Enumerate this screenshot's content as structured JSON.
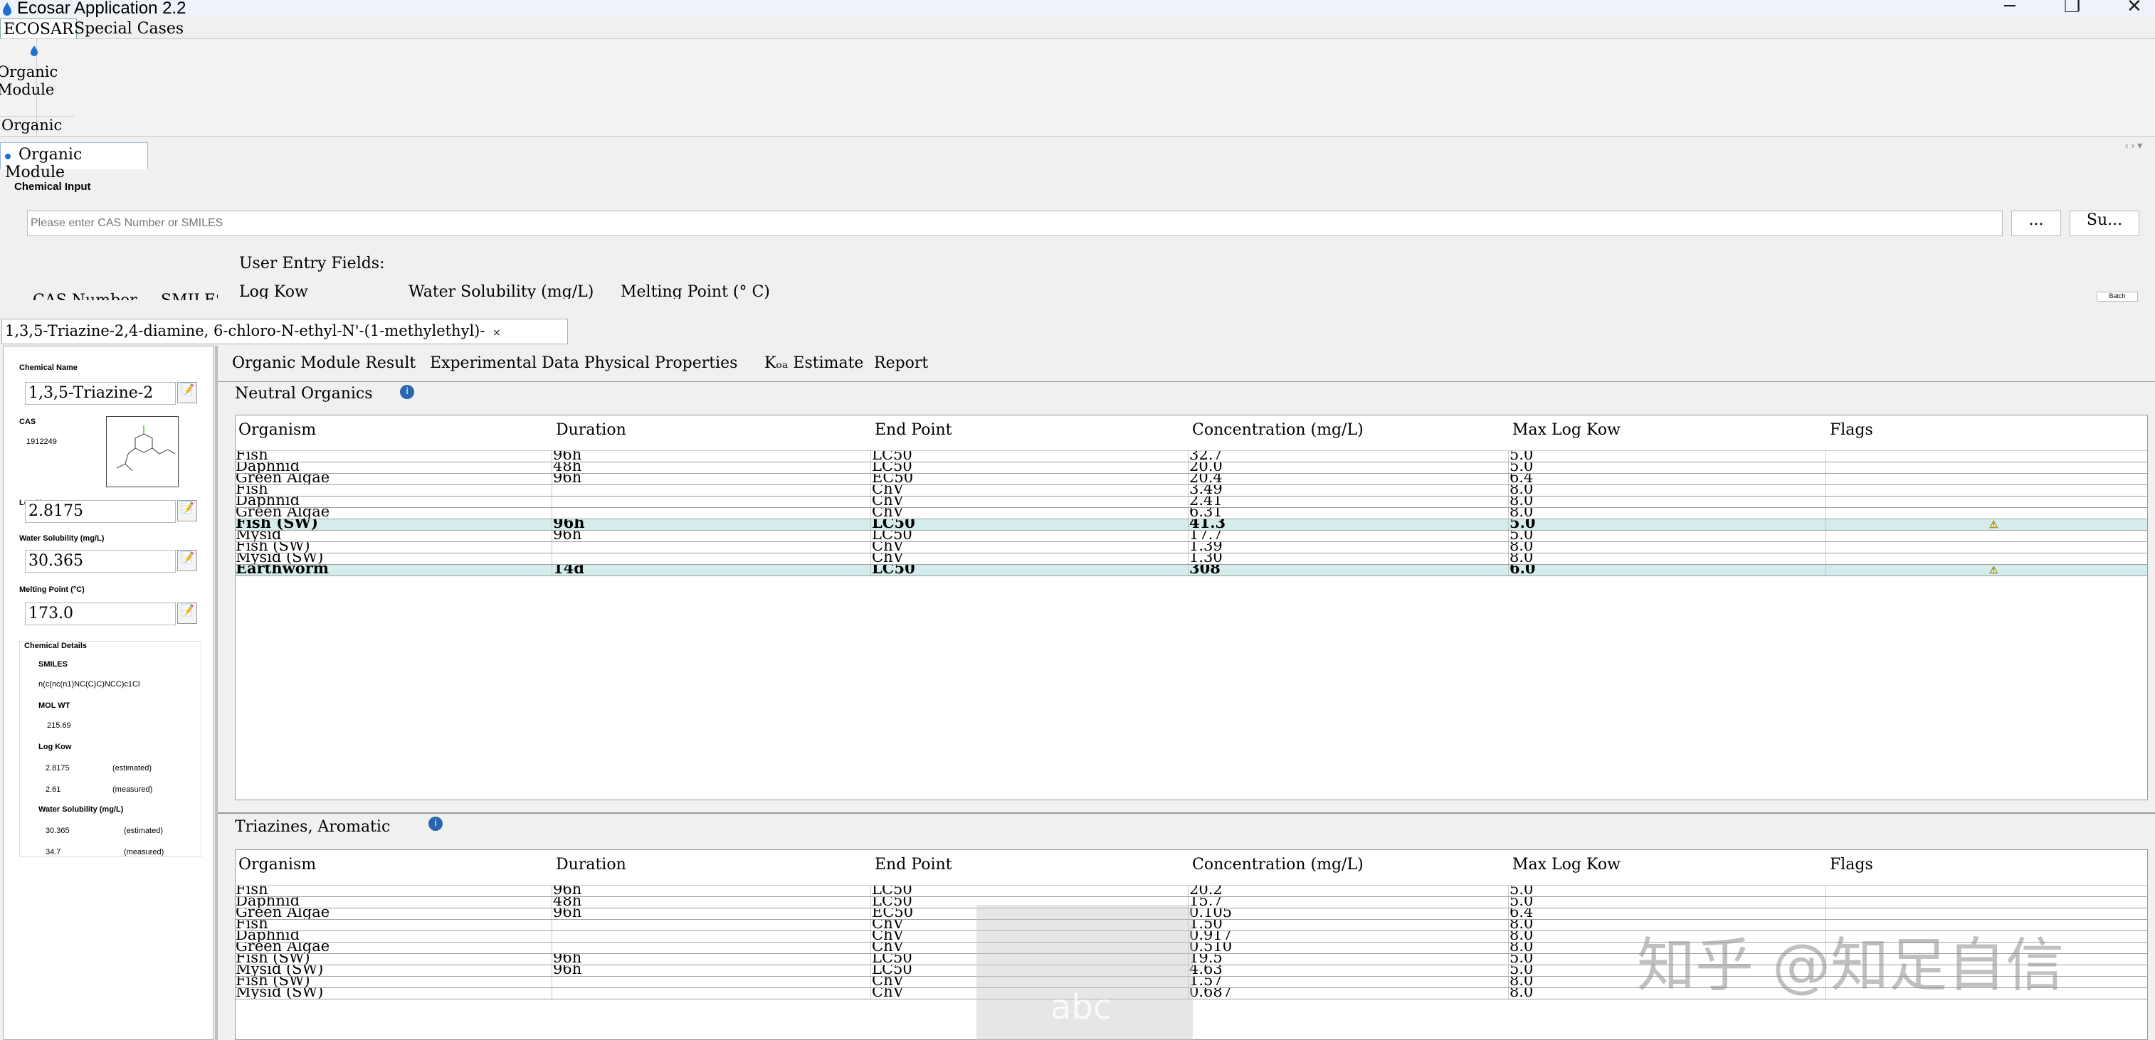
{
  "window": {
    "title": "Ecosar Application 2.2",
    "minimize": "─",
    "restore": "❐",
    "close": "✕"
  },
  "ribbon": {
    "tabs": [
      "ECOSAR",
      "Special Cases"
    ],
    "organic_button_label": "Organic Module",
    "group_label": "Organic"
  },
  "doc_tab": "Organic Module",
  "chemical_input": {
    "label": "Chemical Input",
    "placeholder": "Please enter CAS Number or SMILES",
    "browse_label": "...",
    "submit_label": "Su...",
    "user_entry_label": "User Entry Fields:",
    "fields": [
      "Log Kow",
      "Water Solubility (mg/L)",
      "Melting Point (° C)"
    ],
    "col_headers": [
      "CAS Number",
      "SMILES"
    ],
    "batch_label": "Batch"
  },
  "result_tab": "1,3,5-Triazine-2,4-diamine, 6-chloro-N-ethyl-N'-(1-methylethyl)-",
  "left_panel": {
    "chemical_name_label": "Chemical Name",
    "chemical_name": "1,3,5-Triazine-2",
    "cas_label": "CAS",
    "cas": "1912249",
    "log_kow_label": "Log Kow",
    "log_kow": "2.8175",
    "ws_label": "Water Solubility (mg/L)",
    "ws": "30.365",
    "mp_label": "Melting Point (°C)",
    "mp": "173.0",
    "details_label": "Chemical Details",
    "smiles_label": "SMILES",
    "smiles": "n(c(nc(n1)NC(C)C)NCC)c1Cl",
    "molwt_label": "MOL WT",
    "molwt": "215.69",
    "dlogkow_label": "Log Kow",
    "logkow_est": "2.8175",
    "logkow_est_tag": "(estimated)",
    "logkow_meas": "2.61",
    "logkow_meas_tag": "(measured)",
    "dws_label": "Water Solubility (mg/L)",
    "ws_est": "30.365",
    "ws_est_tag": "(estimated)",
    "ws_meas": "34.7",
    "ws_meas_tag": "(measured)"
  },
  "main_tabs": [
    "Organic Module Result",
    "Experimental Data Physical Properties",
    "Kₒₐ Estimate",
    "Report"
  ],
  "columns": [
    "Organism",
    "Duration",
    "End Point",
    "Concentration (mg/L)",
    "Max Log Kow",
    "Flags"
  ],
  "neutral": {
    "title": "Neutral Organics",
    "rows": [
      {
        "o": "Fish",
        "d": "96h",
        "e": "LC50",
        "c": "32.7",
        "m": "5.0",
        "f": ""
      },
      {
        "o": "Daphnid",
        "d": "48h",
        "e": "LC50",
        "c": "20.0",
        "m": "5.0",
        "f": ""
      },
      {
        "o": "Green Algae",
        "d": "96h",
        "e": "EC50",
        "c": "20.4",
        "m": "6.4",
        "f": ""
      },
      {
        "o": "Fish",
        "d": "",
        "e": "ChV",
        "c": "3.49",
        "m": "8.0",
        "f": ""
      },
      {
        "o": "Daphnid",
        "d": "",
        "e": "ChV",
        "c": "2.41",
        "m": "8.0",
        "f": ""
      },
      {
        "o": "Green Algae",
        "d": "",
        "e": "ChV",
        "c": "6.31",
        "m": "8.0",
        "f": ""
      },
      {
        "o": "Fish (SW)",
        "d": "96h",
        "e": "LC50",
        "c": "41.3",
        "m": "5.0",
        "f": "⚠",
        "hl": true
      },
      {
        "o": "Mysid",
        "d": "96h",
        "e": "LC50",
        "c": "17.7",
        "m": "5.0",
        "f": ""
      },
      {
        "o": "Fish (SW)",
        "d": "",
        "e": "ChV",
        "c": "1.39",
        "m": "8.0",
        "f": ""
      },
      {
        "o": "Mysid (SW)",
        "d": "",
        "e": "ChV",
        "c": "1.30",
        "m": "8.0",
        "f": ""
      },
      {
        "o": "Earthworm",
        "d": "14d",
        "e": "LC50",
        "c": "308",
        "m": "6.0",
        "f": "⚠",
        "hl": true
      }
    ]
  },
  "triazines": {
    "title": "Triazines, Aromatic",
    "rows": [
      {
        "o": "Fish",
        "d": "96h",
        "e": "LC50",
        "c": "20.2",
        "m": "5.0",
        "f": ""
      },
      {
        "o": "Daphnid",
        "d": "48h",
        "e": "LC50",
        "c": "15.7",
        "m": "5.0",
        "f": ""
      },
      {
        "o": "Green Algae",
        "d": "96h",
        "e": "EC50",
        "c": "0.105",
        "m": "6.4",
        "f": ""
      },
      {
        "o": "Fish",
        "d": "",
        "e": "ChV",
        "c": "1.50",
        "m": "8.0",
        "f": ""
      },
      {
        "o": "Daphnid",
        "d": "",
        "e": "ChV",
        "c": "0.917",
        "m": "8.0",
        "f": ""
      },
      {
        "o": "Green Algae",
        "d": "",
        "e": "ChV",
        "c": "0.510",
        "m": "8.0",
        "f": ""
      },
      {
        "o": "Fish (SW)",
        "d": "96h",
        "e": "LC50",
        "c": "19.5",
        "m": "5.0",
        "f": ""
      },
      {
        "o": "Mysid (SW)",
        "d": "96h",
        "e": "LC50",
        "c": "4.63",
        "m": "5.0",
        "f": ""
      },
      {
        "o": "Fish (SW)",
        "d": "",
        "e": "ChV",
        "c": "1.57",
        "m": "8.0",
        "f": ""
      },
      {
        "o": "Mysid (SW)",
        "d": "",
        "e": "ChV",
        "c": "0.687",
        "m": "8.0",
        "f": ""
      }
    ]
  },
  "watermark": "知乎 @知足自信",
  "watermark_abc": "abc"
}
